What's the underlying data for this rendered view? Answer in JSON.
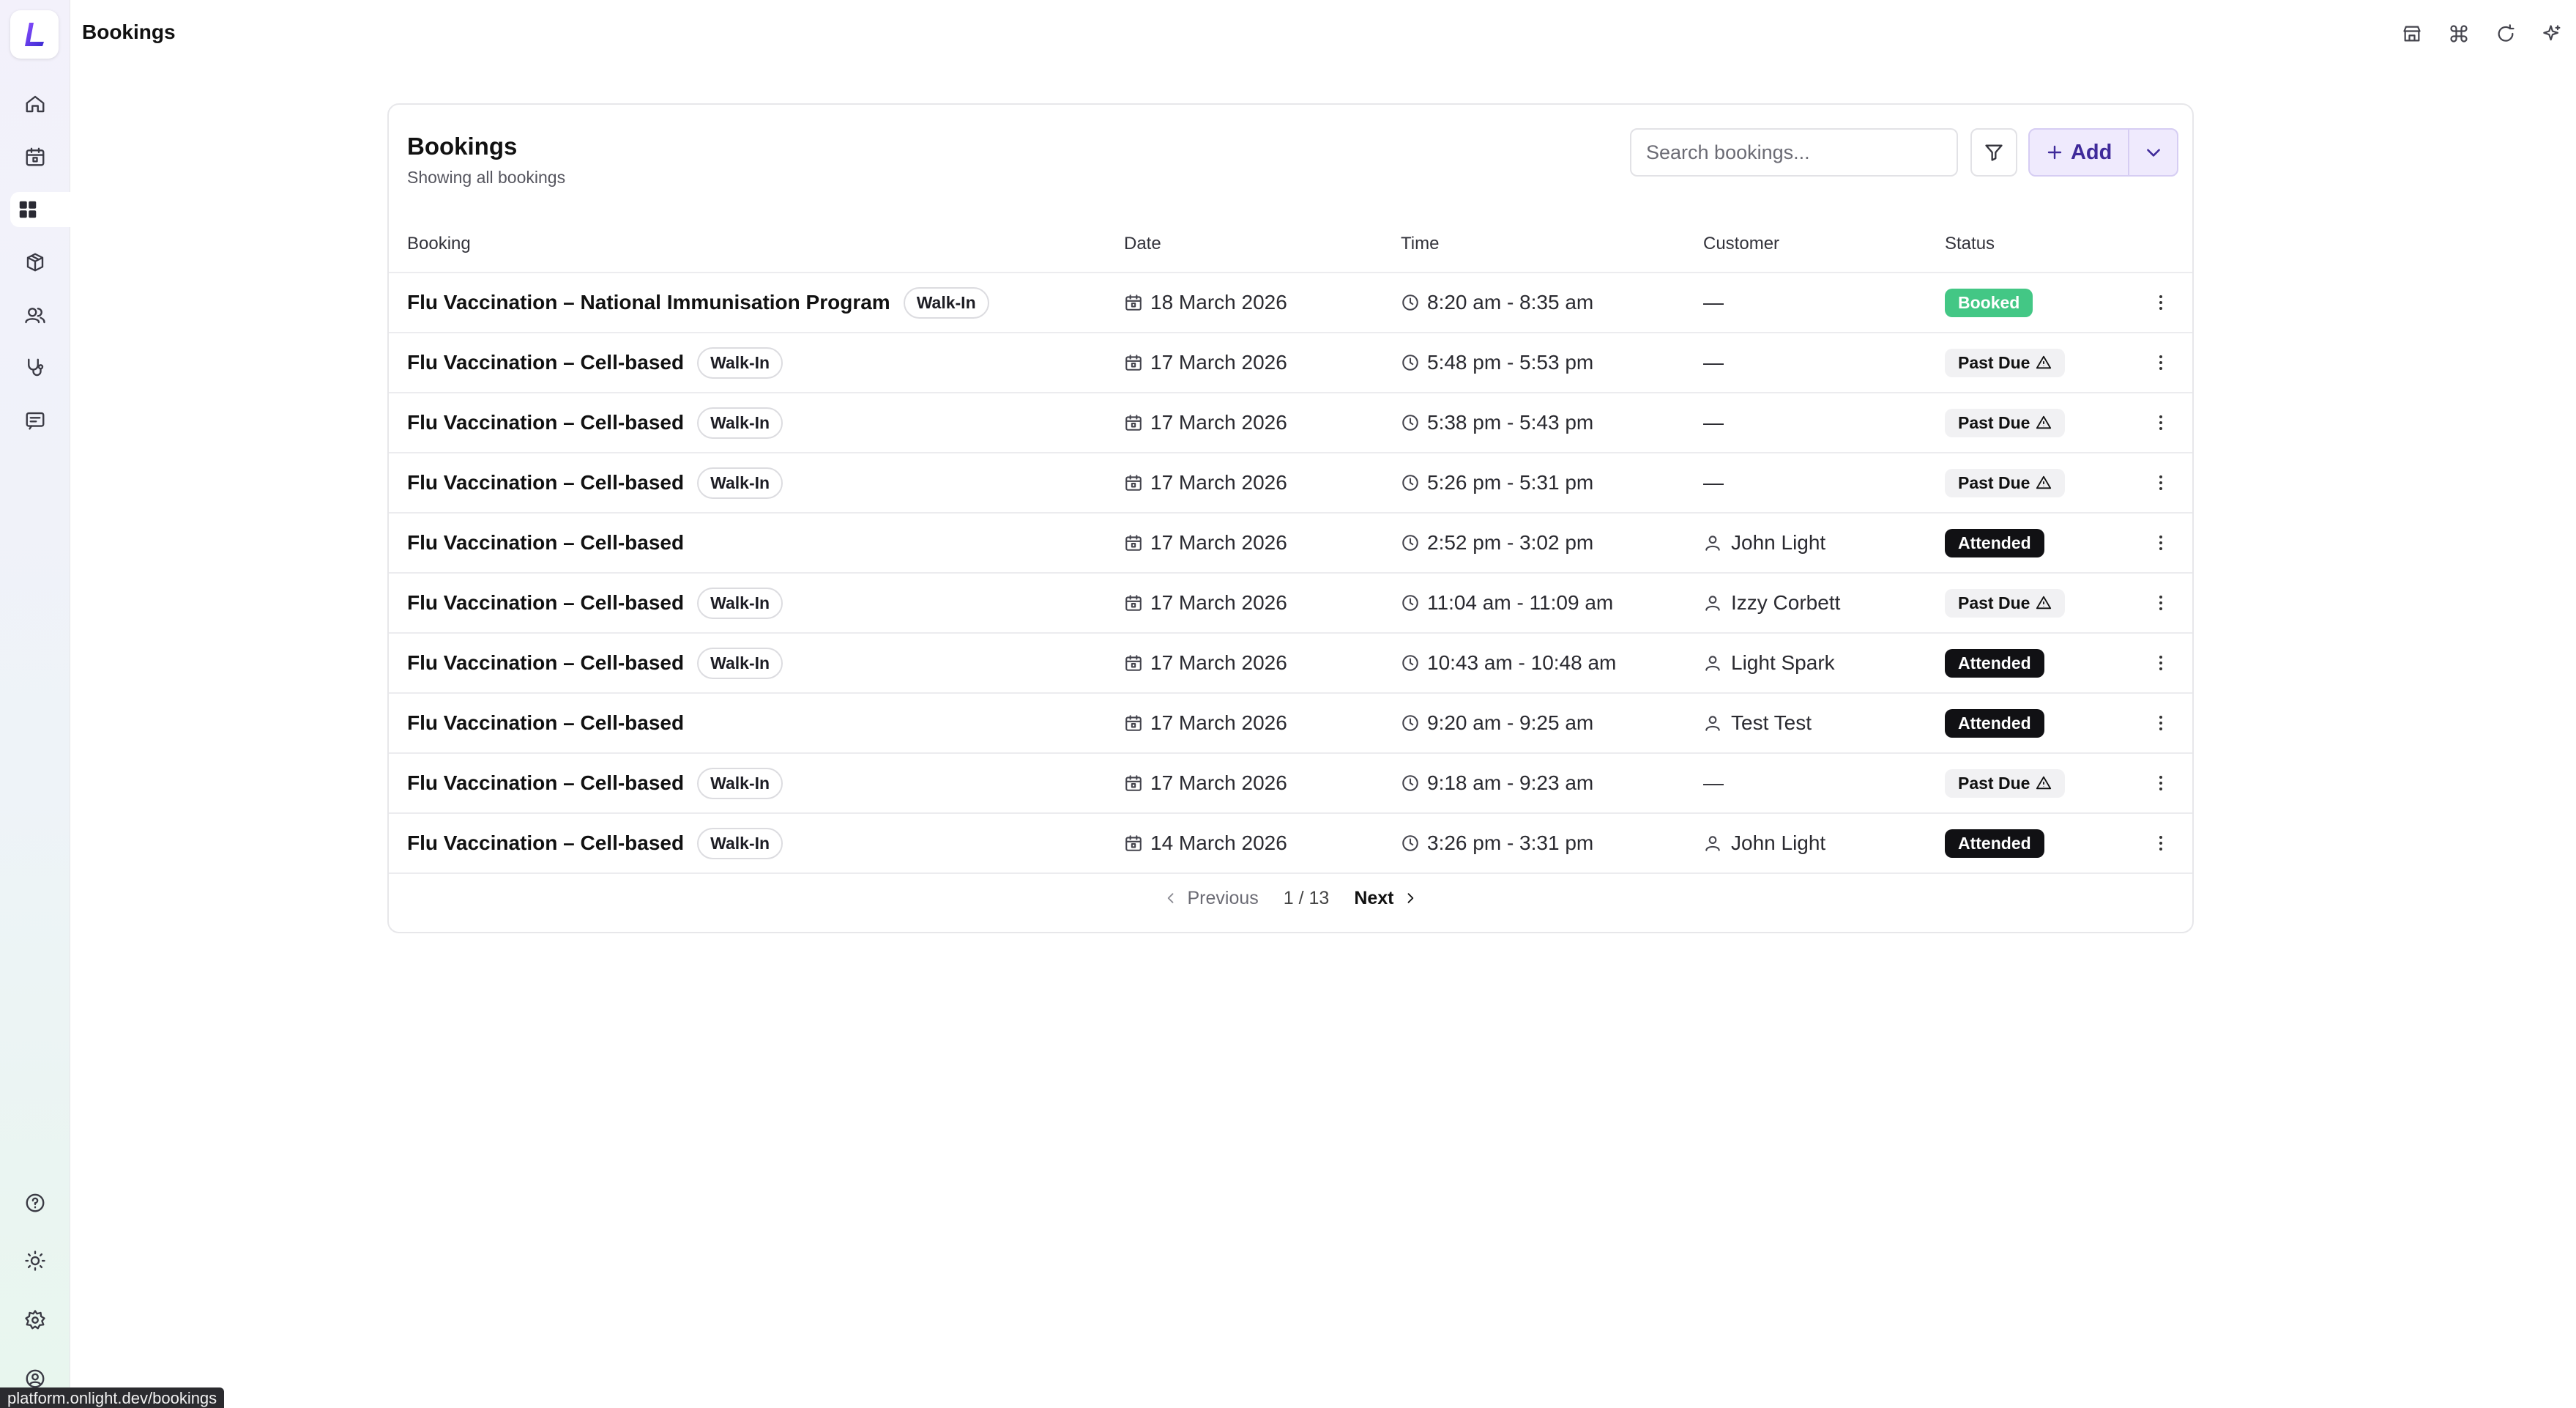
{
  "app": {
    "title": "Bookings",
    "logo": "L"
  },
  "sidebar": {
    "items": [
      {
        "icon": "home-icon"
      },
      {
        "icon": "calendar-icon"
      },
      {
        "icon": "grid-icon",
        "active": true
      },
      {
        "icon": "box-icon"
      },
      {
        "icon": "users-icon"
      },
      {
        "icon": "stethoscope-icon"
      },
      {
        "icon": "message-icon"
      }
    ],
    "bottom": [
      {
        "icon": "help-icon"
      },
      {
        "icon": "sun-icon"
      },
      {
        "icon": "settings-icon"
      },
      {
        "icon": "user-circle-icon"
      }
    ]
  },
  "topbar": {
    "actions": [
      "store-icon",
      "command-icon",
      "refresh-icon",
      "sparkle-icon"
    ]
  },
  "card": {
    "title": "Bookings",
    "subtitle": "Showing all bookings",
    "search_placeholder": "Search bookings...",
    "add_label": "Add"
  },
  "table": {
    "headers": {
      "booking": "Booking",
      "date": "Date",
      "time": "Time",
      "customer": "Customer",
      "status": "Status"
    },
    "rows": [
      {
        "booking": "Flu Vaccination – National Immunisation Program",
        "tag": "Walk-In",
        "date": "18 March 2026",
        "time": "8:20 am - 8:35 am",
        "customer": "—",
        "has_customer": false,
        "status": "Booked",
        "status_type": "booked"
      },
      {
        "booking": "Flu Vaccination – Cell-based",
        "tag": "Walk-In",
        "date": "17 March 2026",
        "time": "5:48 pm - 5:53 pm",
        "customer": "—",
        "has_customer": false,
        "status": "Past Due",
        "status_type": "pastdue"
      },
      {
        "booking": "Flu Vaccination – Cell-based",
        "tag": "Walk-In",
        "date": "17 March 2026",
        "time": "5:38 pm - 5:43 pm",
        "customer": "—",
        "has_customer": false,
        "status": "Past Due",
        "status_type": "pastdue"
      },
      {
        "booking": "Flu Vaccination – Cell-based",
        "tag": "Walk-In",
        "date": "17 March 2026",
        "time": "5:26 pm - 5:31 pm",
        "customer": "—",
        "has_customer": false,
        "status": "Past Due",
        "status_type": "pastdue"
      },
      {
        "booking": "Flu Vaccination – Cell-based",
        "tag": "",
        "date": "17 March 2026",
        "time": "2:52 pm - 3:02 pm",
        "customer": "John Light",
        "has_customer": true,
        "status": "Attended",
        "status_type": "attended"
      },
      {
        "booking": "Flu Vaccination – Cell-based",
        "tag": "Walk-In",
        "date": "17 March 2026",
        "time": "11:04 am - 11:09 am",
        "customer": "Izzy Corbett",
        "has_customer": true,
        "status": "Past Due",
        "status_type": "pastdue"
      },
      {
        "booking": "Flu Vaccination – Cell-based",
        "tag": "Walk-In",
        "date": "17 March 2026",
        "time": "10:43 am - 10:48 am",
        "customer": "Light Spark",
        "has_customer": true,
        "status": "Attended",
        "status_type": "attended"
      },
      {
        "booking": "Flu Vaccination – Cell-based",
        "tag": "",
        "date": "17 March 2026",
        "time": "9:20 am - 9:25 am",
        "customer": "Test Test",
        "has_customer": true,
        "status": "Attended",
        "status_type": "attended"
      },
      {
        "booking": "Flu Vaccination – Cell-based",
        "tag": "Walk-In",
        "date": "17 March 2026",
        "time": "9:18 am - 9:23 am",
        "customer": "—",
        "has_customer": false,
        "status": "Past Due",
        "status_type": "pastdue"
      },
      {
        "booking": "Flu Vaccination – Cell-based",
        "tag": "Walk-In",
        "date": "14 March 2026",
        "time": "3:26 pm - 3:31 pm",
        "customer": "John Light",
        "has_customer": true,
        "status": "Attended",
        "status_type": "attended"
      }
    ]
  },
  "pagination": {
    "previous": "Previous",
    "page": "1 / 13",
    "next": "Next"
  },
  "status_url": "platform.onlight.dev/bookings",
  "colors": {
    "accent": "#3f2a9a",
    "booked": "#43c785",
    "attended": "#111114",
    "past_due_bg": "#f1f1f3"
  }
}
